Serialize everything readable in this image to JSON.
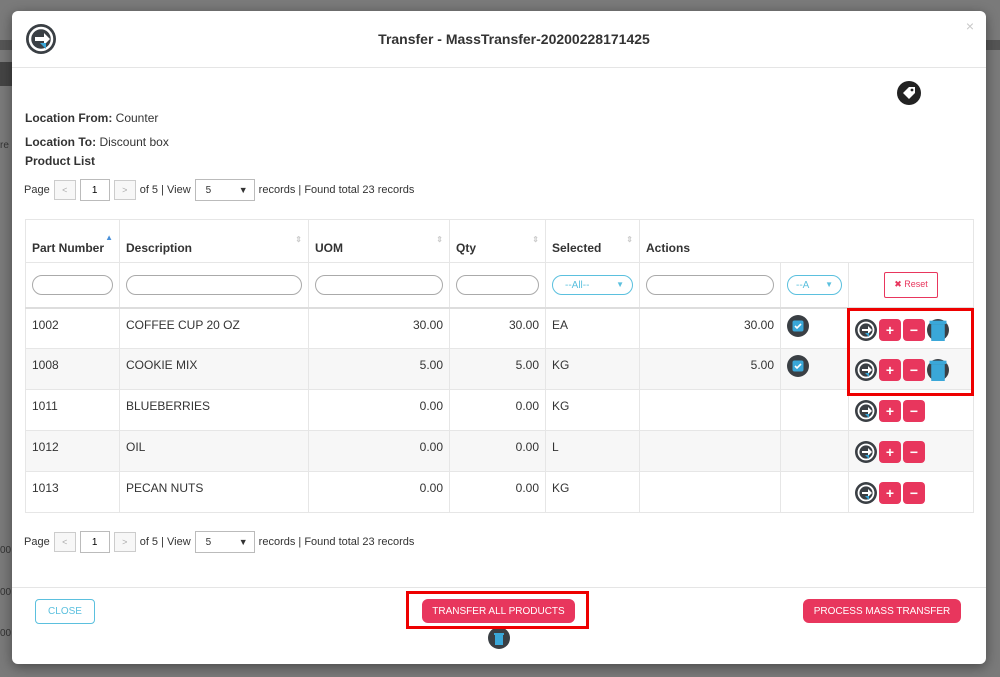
{
  "modal": {
    "title": "Transfer - MassTransfer-20200228171425",
    "close_glyph": "×",
    "logo_icon": "transfer-logo-icon",
    "tag_icon": "price-tag-icon"
  },
  "info": {
    "location_from_label": "Location From:",
    "location_from_value": "Counter",
    "location_to_label": "Location To:",
    "location_to_value": "Discount box",
    "product_list_label": "Product List"
  },
  "pager": {
    "page_label": "Page",
    "prev_glyph": "<",
    "next_glyph": ">",
    "current_page": "1",
    "of_text": "of 5 | View",
    "view_value": "5",
    "records_text": "records | Found total 23 records"
  },
  "table": {
    "columns": [
      "Part Number",
      "Description",
      "UOM",
      "Qty",
      "Selected",
      "Actions"
    ],
    "filter_selected_value": "--All--",
    "filter_checkbox_value": "--A",
    "reset_label": "✖ Reset",
    "rows": [
      {
        "part": "1002",
        "desc": "COFFEE CUP 20 OZ",
        "qty_a": "30.00",
        "qty_b": "30.00",
        "uom": "EA",
        "selected": "30.00",
        "checked": true
      },
      {
        "part": "1008",
        "desc": "COOKIE MIX",
        "qty_a": "5.00",
        "qty_b": "5.00",
        "uom": "KG",
        "selected": "5.00",
        "checked": true
      },
      {
        "part": "1011",
        "desc": "BLUEBERRIES",
        "qty_a": "0.00",
        "qty_b": "0.00",
        "uom": "KG",
        "selected": "",
        "checked": false
      },
      {
        "part": "1012",
        "desc": "OIL",
        "qty_a": "0.00",
        "qty_b": "0.00",
        "uom": "L",
        "selected": "",
        "checked": false
      },
      {
        "part": "1013",
        "desc": "PECAN NUTS",
        "qty_a": "0.00",
        "qty_b": "0.00",
        "uom": "KG",
        "selected": "",
        "checked": false
      }
    ]
  },
  "footer": {
    "close_label": "CLOSE",
    "transfer_all_label": "TRANSFER ALL PRODUCTS",
    "process_label": "PROCESS MASS TRANSFER"
  },
  "background": {
    "frag_re": "re",
    "frag_1": "00",
    "frag_2": "00",
    "frag_3": "00"
  },
  "colors": {
    "accent_pink": "#e8365d",
    "accent_cyan": "#5bc0de",
    "dark_icon": "#3a3f44",
    "highlight_red": "#ee0000"
  }
}
